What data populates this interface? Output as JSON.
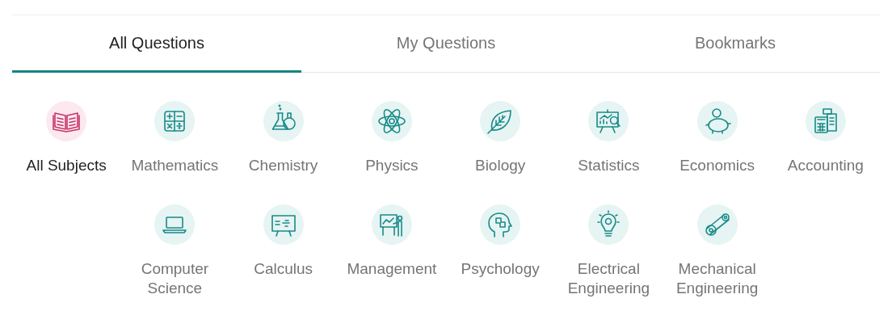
{
  "tabs": [
    {
      "label": "All Questions",
      "selected": true
    },
    {
      "label": "My Questions",
      "selected": false
    },
    {
      "label": "Bookmarks",
      "selected": false
    }
  ],
  "subjects": [
    {
      "label": "All Subjects",
      "selected": true
    },
    {
      "label": "Mathematics",
      "selected": false
    },
    {
      "label": "Chemistry",
      "selected": false
    },
    {
      "label": "Physics",
      "selected": false
    },
    {
      "label": "Biology",
      "selected": false
    },
    {
      "label": "Statistics",
      "selected": false
    },
    {
      "label": "Economics",
      "selected": false
    },
    {
      "label": "Accounting",
      "selected": false
    },
    {
      "label": "Computer Science",
      "selected": false
    },
    {
      "label": "Calculus",
      "selected": false
    },
    {
      "label": "Management",
      "selected": false
    },
    {
      "label": "Psychology",
      "selected": false
    },
    {
      "label": "Electrical Engineering",
      "selected": false
    },
    {
      "label": "Mechanical Engineering",
      "selected": false
    }
  ]
}
